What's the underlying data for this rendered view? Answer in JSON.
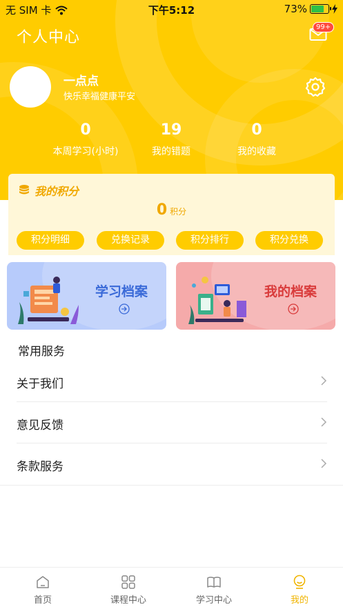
{
  "status_bar": {
    "carrier": "无 SIM 卡",
    "time": "下午5:12",
    "battery": "73%",
    "battery_level": 0.73
  },
  "header": {
    "title": "个人中心",
    "mail_badge": "99+"
  },
  "profile": {
    "name": "一点点",
    "motto": "快乐幸福健康平安"
  },
  "stats": [
    {
      "value": "0",
      "label": "本周学习(小时)"
    },
    {
      "value": "19",
      "label": "我的错题"
    },
    {
      "value": "0",
      "label": "我的收藏"
    }
  ],
  "points": {
    "title": "我的积分",
    "value": "0",
    "unit": "积分",
    "buttons": [
      "积分明细",
      "兑换记录",
      "积分排行",
      "积分兑换"
    ]
  },
  "archives": {
    "study": "学习档案",
    "mine": "我的档案"
  },
  "services": {
    "title": "常用服务",
    "items": [
      "关于我们",
      "意见反馈",
      "条款服务"
    ]
  },
  "tabbar": {
    "tabs": [
      "首页",
      "课程中心",
      "学习中心",
      "我的"
    ],
    "active": "我的"
  },
  "colors": {
    "accent": "#ffcc00",
    "active_tab": "#f0b400",
    "badge": "#ff4a3d"
  }
}
